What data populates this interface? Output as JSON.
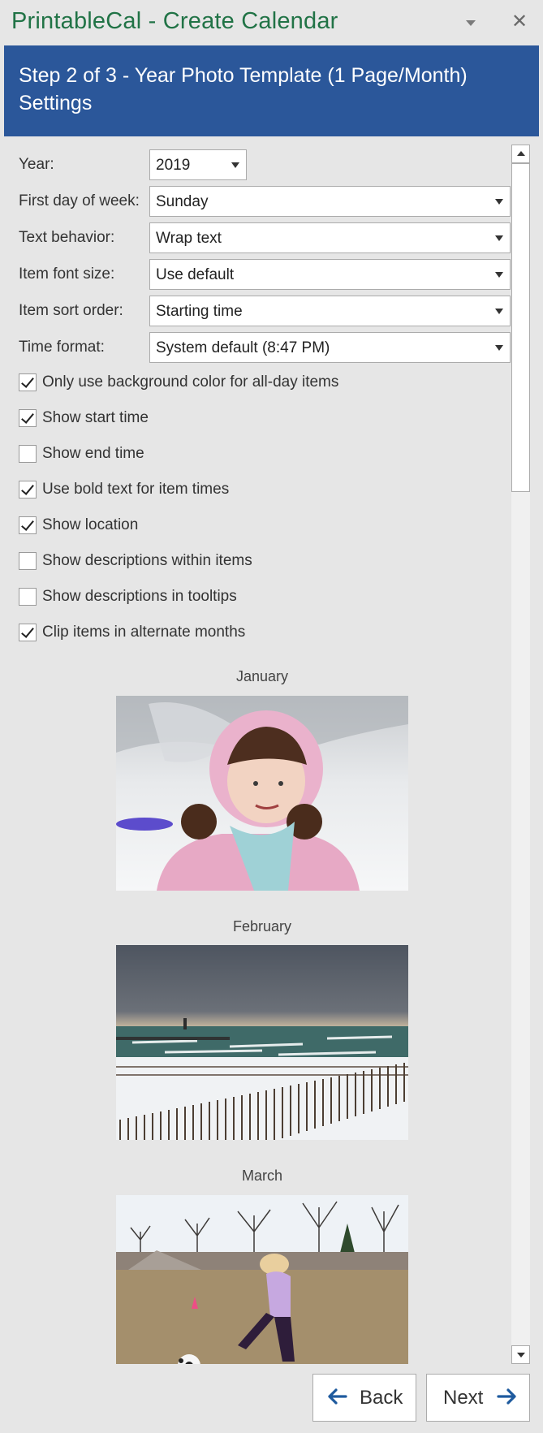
{
  "window": {
    "title": "PrintableCal - Create Calendar",
    "menu_icon": "chevron-down-icon",
    "close_icon": "close-icon",
    "close_glyph": "✕"
  },
  "banner": {
    "line1": "Step 2 of 3 - Year Photo Template (1 Page/Month)",
    "line2": "Settings",
    "color": "#2b579a"
  },
  "settings": {
    "year": {
      "label": "Year:",
      "value": "2019"
    },
    "first_day_of_week": {
      "label": "First day of week:",
      "value": "Sunday"
    },
    "text_behavior": {
      "label": "Text behavior:",
      "value": "Wrap text"
    },
    "item_font_size": {
      "label": "Item font size:",
      "value": "Use default"
    },
    "item_sort_order": {
      "label": "Item sort order:",
      "value": "Starting time"
    },
    "time_format": {
      "label": "Time format:",
      "value": "System default (8:47 PM)"
    }
  },
  "checkboxes": [
    {
      "label": "Only use background color for all-day items",
      "checked": true
    },
    {
      "label": "Show start time",
      "checked": true
    },
    {
      "label": "Show end time",
      "checked": false
    },
    {
      "label": "Use bold text for item times",
      "checked": true
    },
    {
      "label": "Show location",
      "checked": true
    },
    {
      "label": "Show descriptions within items",
      "checked": false
    },
    {
      "label": "Show descriptions in tooltips",
      "checked": false
    },
    {
      "label": "Clip items in alternate months",
      "checked": true
    }
  ],
  "months": [
    {
      "label": "January",
      "photo": "girl-in-pink-snowsuit-photo"
    },
    {
      "label": "February",
      "photo": "snowy-beach-lighthouse-photo"
    },
    {
      "label": "March",
      "photo": "girl-kicking-soccer-ball-photo"
    }
  ],
  "footer": {
    "back_label": "Back",
    "next_label": "Next",
    "arrow_color": "#1e5a9e"
  }
}
